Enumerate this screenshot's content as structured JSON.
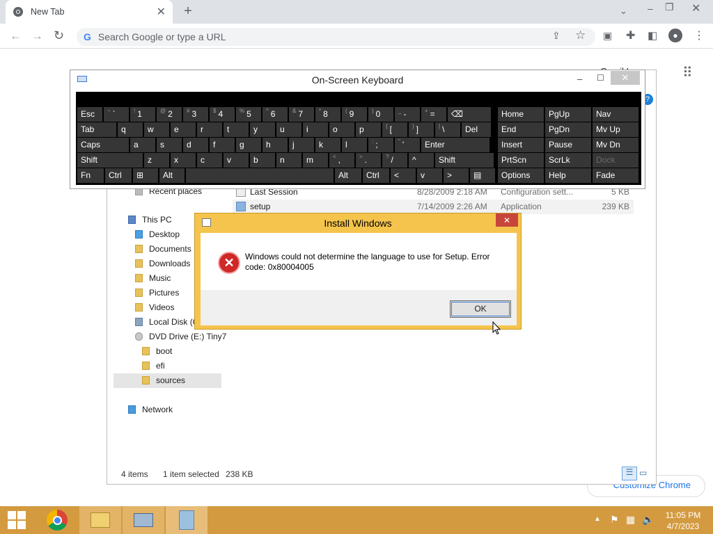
{
  "browser": {
    "tab_title": "New Tab",
    "omnibox_placeholder": "Search Google or type a URL",
    "customize_label": "Customize Chrome",
    "peek_label": "Gmail  Images"
  },
  "explorer": {
    "tree": {
      "recent_places": "Recent places",
      "this_pc": "This PC",
      "desktop": "Desktop",
      "documents": "Documents",
      "downloads": "Downloads",
      "music": "Music",
      "pictures": "Pictures",
      "videos": "Videos",
      "local_disk": "Local Disk (C",
      "dvd_drive": "DVD Drive (E:) Tiny7",
      "boot": "boot",
      "efi": "efi",
      "sources": "sources",
      "network": "Network"
    },
    "files": [
      {
        "name": "Last Session",
        "date": "8/28/2009 2:18 AM",
        "type": "Configuration sett...",
        "size": "5 KB"
      },
      {
        "name": "setup",
        "date": "7/14/2009 2:26 AM",
        "type": "Application",
        "size": "239 KB"
      }
    ],
    "status": {
      "items": "4 items",
      "selected": "1 item selected",
      "size": "238 KB"
    }
  },
  "osk": {
    "title": "On-Screen Keyboard",
    "row1": [
      {
        "label": "Esc"
      },
      {
        "shift": "~",
        "main": "`"
      },
      {
        "shift": "!",
        "main": "1"
      },
      {
        "shift": "@",
        "main": "2"
      },
      {
        "shift": "#",
        "main": "3"
      },
      {
        "shift": "$",
        "main": "4"
      },
      {
        "shift": "%",
        "main": "5"
      },
      {
        "shift": "^",
        "main": "6"
      },
      {
        "shift": "&",
        "main": "7"
      },
      {
        "shift": "*",
        "main": "8"
      },
      {
        "shift": "(",
        "main": "9"
      },
      {
        "shift": ")",
        "main": "0"
      },
      {
        "shift": "_",
        "main": "-"
      },
      {
        "shift": "+",
        "main": "="
      },
      {
        "label": "⌫"
      }
    ],
    "row2": [
      "Tab",
      "q",
      "w",
      "e",
      "r",
      "t",
      "y",
      "u",
      "i",
      "o",
      "p",
      "[",
      "]",
      "\\",
      "Del"
    ],
    "row2_shift": {
      "[": "{",
      "]": "}",
      "\\": "|"
    },
    "row3": [
      "Caps",
      "a",
      "s",
      "d",
      "f",
      "g",
      "h",
      "j",
      "k",
      "l",
      ";",
      "'",
      "Enter"
    ],
    "row3_shift": {
      ";": ":",
      "'": "\""
    },
    "row4": [
      "Shift",
      "z",
      "x",
      "c",
      "v",
      "b",
      "n",
      "m",
      ",",
      ".",
      "/",
      "^",
      "Shift"
    ],
    "row4_shift": {
      ",": "<",
      ".": ">",
      "/": "?"
    },
    "row5": [
      "Fn",
      "Ctrl",
      "⊞",
      "Alt",
      "",
      "Alt",
      "Ctrl",
      "<",
      "v",
      ">",
      "▤"
    ],
    "nav": [
      [
        "Home",
        "PgUp",
        "Nav"
      ],
      [
        "End",
        "PgDn",
        "Mv Up"
      ],
      [
        "Insert",
        "Pause",
        "Mv Dn"
      ],
      [
        "PrtScn",
        "ScrLk",
        "Dock"
      ],
      [
        "Options",
        "Help",
        "Fade"
      ]
    ]
  },
  "dialog": {
    "title": "Install Windows",
    "message": "Windows could not determine the language to use for Setup. Error code: 0x80004005",
    "ok_label": "OK"
  },
  "taskbar": {
    "time": "11:05 PM",
    "date": "4/7/2023"
  },
  "colors": {
    "taskbar": "#d39a3f",
    "dialog_frame": "#f5c44d",
    "close_red": "#c7453a",
    "osk_key": "#363636"
  }
}
